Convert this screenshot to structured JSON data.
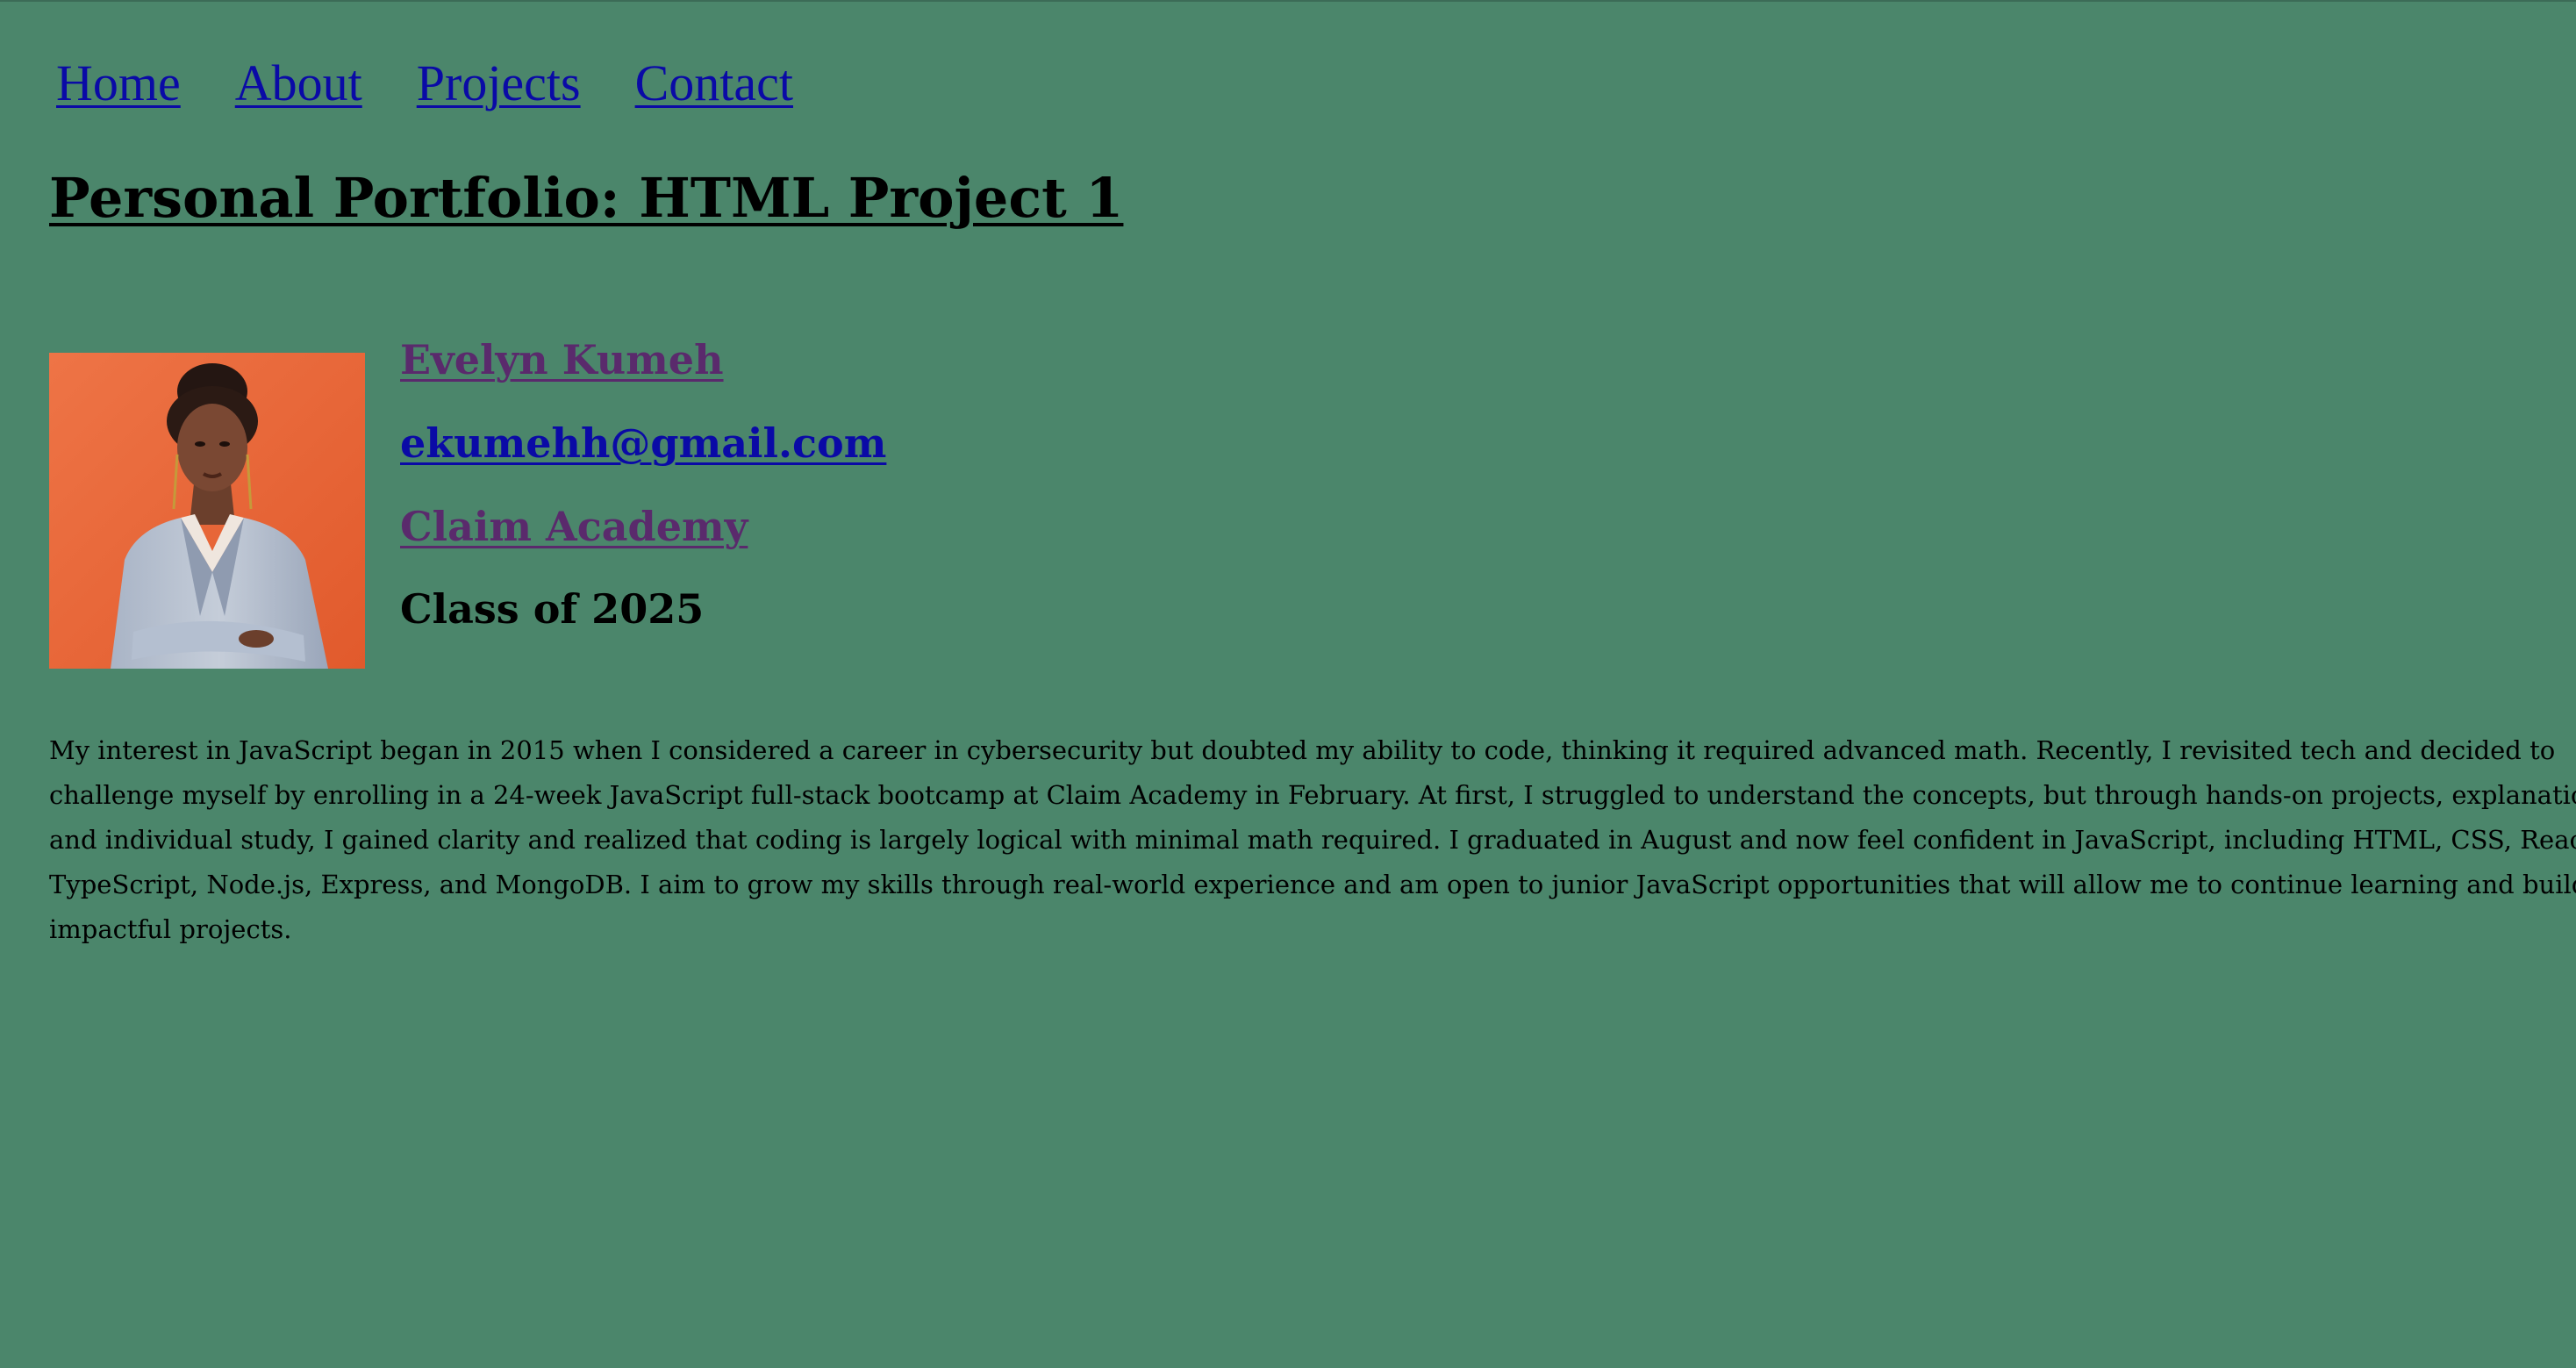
{
  "nav": {
    "home": "Home",
    "about": "About",
    "projects": "Projects",
    "contact": "Contact"
  },
  "page_title": "Personal Portfolio: HTML Project 1",
  "profile": {
    "photo_icon": "portrait-photo",
    "name": "Evelyn Kumeh",
    "email": "ekumehh@gmail.com",
    "school": "Claim Academy",
    "class": "Class of 2025"
  },
  "bio": "My interest in JavaScript began in 2015 when I considered a career in cybersecurity but doubted my ability to code, thinking it required advanced math. Recently, I revisited tech and decided to challenge myself by enrolling in a 24-week JavaScript full-stack bootcamp at Claim Academy in February. At first, I struggled to understand the concepts, but through hands-on projects, explanations, and individual study, I gained clarity and realized that coding is largely logical with minimal math required. I graduated in August and now feel confident in JavaScript, including HTML, CSS, React, TypeScript, Node.js, Express, and MongoDB. I aim to grow my skills through real-world experience and am open to junior JavaScript opportunities that will allow me to continue learning and building impactful projects.",
  "colors": {
    "background": "#4b866b",
    "link": "#0a0aa6",
    "visited_link": "#5a2a6c",
    "photo_background": "#e8673a"
  }
}
